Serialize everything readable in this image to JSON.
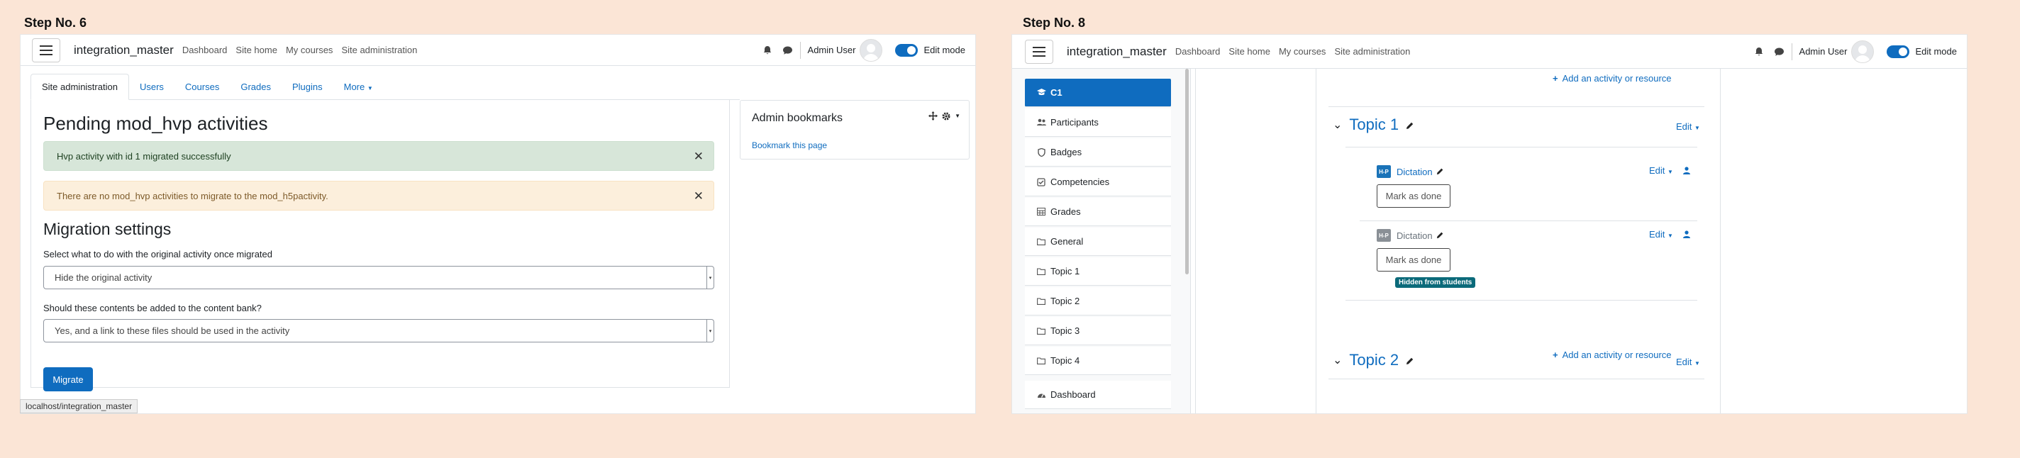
{
  "left": {
    "step_label": "Step No. 6",
    "navbar": {
      "brand": "integration_master",
      "links": [
        "Dashboard",
        "Site home",
        "My courses",
        "Site administration"
      ],
      "user_name": "Admin User",
      "edit_mode_label": "Edit mode"
    },
    "tabs": [
      "Site administration",
      "Users",
      "Courses",
      "Grades",
      "Plugins",
      "More"
    ],
    "page_title": "Pending mod_hvp activities",
    "alerts": {
      "success": "Hvp activity with id 1 migrated successfully",
      "warning": "There are no mod_hvp activities to migrate to the mod_h5pactivity."
    },
    "close_glyph": "✕",
    "section_title": "Migration settings",
    "fields": {
      "original_label": "Select what to do with the original activity once migrated",
      "original_value": "Hide the original activity",
      "content_bank_label": "Should these contents be added to the content bank?",
      "content_bank_value": "Yes, and a link to these files should be used in the activity"
    },
    "migrate_button": "Migrate",
    "block": {
      "title": "Admin bookmarks",
      "link": "Bookmark this page"
    },
    "status_url": "localhost/integration_master"
  },
  "right": {
    "step_label": "Step No. 8",
    "navbar": {
      "brand": "integration_master",
      "links": [
        "Dashboard",
        "Site home",
        "My courses",
        "Site administration"
      ],
      "user_name": "Admin User",
      "edit_mode_label": "Edit mode"
    },
    "drawer_items": [
      {
        "label": "C1",
        "icon": "graduation-cap-icon"
      },
      {
        "label": "Participants",
        "icon": "users-icon"
      },
      {
        "label": "Badges",
        "icon": "shield-icon"
      },
      {
        "label": "Competencies",
        "icon": "check-square-icon"
      },
      {
        "label": "Grades",
        "icon": "table-icon"
      },
      {
        "label": "General",
        "icon": "folder-icon"
      },
      {
        "label": "Topic 1",
        "icon": "folder-icon"
      },
      {
        "label": "Topic 2",
        "icon": "folder-icon"
      },
      {
        "label": "Topic 3",
        "icon": "folder-icon"
      },
      {
        "label": "Topic 4",
        "icon": "folder-icon"
      },
      {
        "label": "Dashboard",
        "icon": "tachometer-icon"
      }
    ],
    "add_activity": "Add an activity or resource",
    "topic1": "Topic 1",
    "topic2": "Topic 2",
    "edit_label": "Edit",
    "hvp_badge": "H-P",
    "activity1": "Dictation",
    "activity2": "Dictation",
    "mark_done": "Mark as done",
    "hidden_badge": "Hidden from students"
  },
  "colors": {
    "page_background": "#fbe5d6",
    "primary": "#0f6cbf",
    "success_bg": "#d7e6d9",
    "warning_bg": "#fcefdc",
    "hidden_badge": "#0b6a7a"
  }
}
